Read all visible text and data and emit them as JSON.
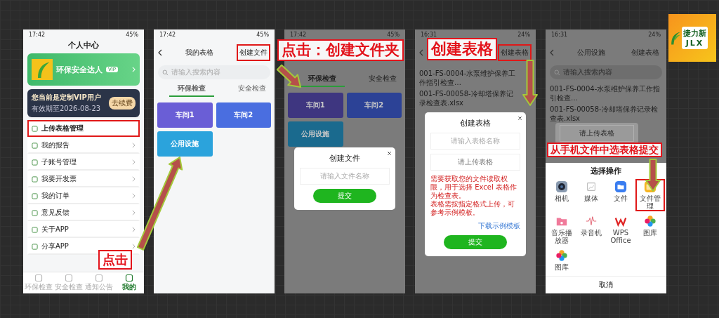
{
  "logo": {
    "name": "捷力新",
    "letters": "JLX"
  },
  "screens": [
    {
      "kind": "profile",
      "status": {
        "time": "17:42",
        "battery": "45%"
      },
      "title": "个人中心",
      "user": {
        "name": "环保安全达人",
        "badge": "VIP"
      },
      "vip": {
        "text": "您当前是定制VIP用户",
        "expiry": "有效期至2026-08-23",
        "button": "去续费"
      },
      "menu": [
        {
          "label": "上传表格管理",
          "highlighted": true
        },
        {
          "label": "我的报告",
          "highlighted": false
        },
        {
          "label": "子账号管理",
          "highlighted": false
        },
        {
          "label": "我要开发票",
          "highlighted": false
        },
        {
          "label": "我的订单",
          "highlighted": false
        },
        {
          "label": "意见反馈",
          "highlighted": false
        },
        {
          "label": "关于APP",
          "highlighted": false
        },
        {
          "label": "分享APP",
          "highlighted": false
        }
      ],
      "tabbar": [
        {
          "label": "环保检查",
          "selected": false
        },
        {
          "label": "安全检查",
          "selected": false
        },
        {
          "label": "通知公告",
          "selected": false
        },
        {
          "label": "我的",
          "selected": true
        }
      ]
    },
    {
      "kind": "folders",
      "status": {
        "time": "17:42",
        "battery": "45%"
      },
      "title": "我的表格",
      "action": {
        "label": "创建文件",
        "highlighted": true
      },
      "search": {
        "placeholder": "请输入搜索内容"
      },
      "tabs": [
        {
          "label": "环保检查",
          "selected": true
        },
        {
          "label": "安全检查",
          "selected": false
        }
      ],
      "folders": [
        {
          "name": "车间1",
          "color": "#6a5ed6"
        },
        {
          "name": "车间2",
          "color": "#4a6ee0"
        },
        {
          "name": "公用设施",
          "color": "#2ba3dc"
        }
      ]
    },
    {
      "kind": "folders_modal",
      "status": {
        "time": "17:42",
        "battery": "45%"
      },
      "tabs": [
        {
          "label": "环保检查",
          "selected": true
        },
        {
          "label": "安全检查",
          "selected": false
        }
      ],
      "folders": [
        {
          "name": "车间1",
          "color": "#3e3680"
        },
        {
          "name": "车间2",
          "color": "#2c4296"
        },
        {
          "name": "公用设施",
          "color": "#1a6a8e"
        }
      ],
      "dialog": {
        "title": "创建文件",
        "placeholder": "请输入文件名称",
        "submit": "提交"
      }
    },
    {
      "kind": "files_modal",
      "status": {
        "time": "16:31",
        "battery": "24%"
      },
      "action": {
        "label": "创建表格",
        "highlighted": true
      },
      "files": [
        {
          "name": "001-FS-0004-水泵维护保养工作指引检查…"
        },
        {
          "name": "001-FS-00058-冷却塔保养记录检查表.xlsx"
        }
      ],
      "dialog": {
        "title": "创建表格",
        "placeholder": "请输入表格名称",
        "upload": "请上传表格",
        "notes": [
          "需要获取您的文件读取权限，用于选择 Excel 表格作为检查表。",
          "表格需按指定格式上传，可参考示例模板。"
        ],
        "link": "下载示例模板",
        "submit": "提交"
      }
    },
    {
      "kind": "files_sheet",
      "status": {
        "time": "16:31",
        "battery": "24%"
      },
      "title": "公用设施",
      "action": {
        "label": "创建表格",
        "highlighted": false
      },
      "search": {
        "placeholder": "请输入搜索内容"
      },
      "files": [
        {
          "name": "001-FS-0004-水泵维护保养工作指引检查…"
        },
        {
          "name": "001-FS-00058-冷却塔保养记录检查表.xlsx"
        }
      ],
      "dialog": {
        "upload": "请上传表格"
      },
      "sheet": {
        "title": "选择操作",
        "apps": [
          {
            "label": "相机",
            "kind": "camera",
            "highlighted": false
          },
          {
            "label": "媒体",
            "kind": "media",
            "highlighted": false
          },
          {
            "label": "文件",
            "kind": "files",
            "highlighted": false
          },
          {
            "label": "文件管理",
            "kind": "manager",
            "highlighted": true
          },
          {
            "label": "音乐播放器",
            "kind": "music",
            "highlighted": false
          },
          {
            "label": "录音机",
            "kind": "recorder",
            "highlighted": false
          },
          {
            "label": "WPS Office",
            "kind": "wps",
            "highlighted": false
          },
          {
            "label": "图库",
            "kind": "gallery",
            "highlighted": false
          },
          {
            "label": "图库",
            "kind": "gallery",
            "highlighted": false
          }
        ],
        "cancel": "取消"
      }
    }
  ],
  "callouts": [
    {
      "text": "点击"
    },
    {
      "text": "点击：创建文件夹"
    },
    {
      "text": "创建表格"
    },
    {
      "text": "从手机文件中选表格提交"
    }
  ]
}
